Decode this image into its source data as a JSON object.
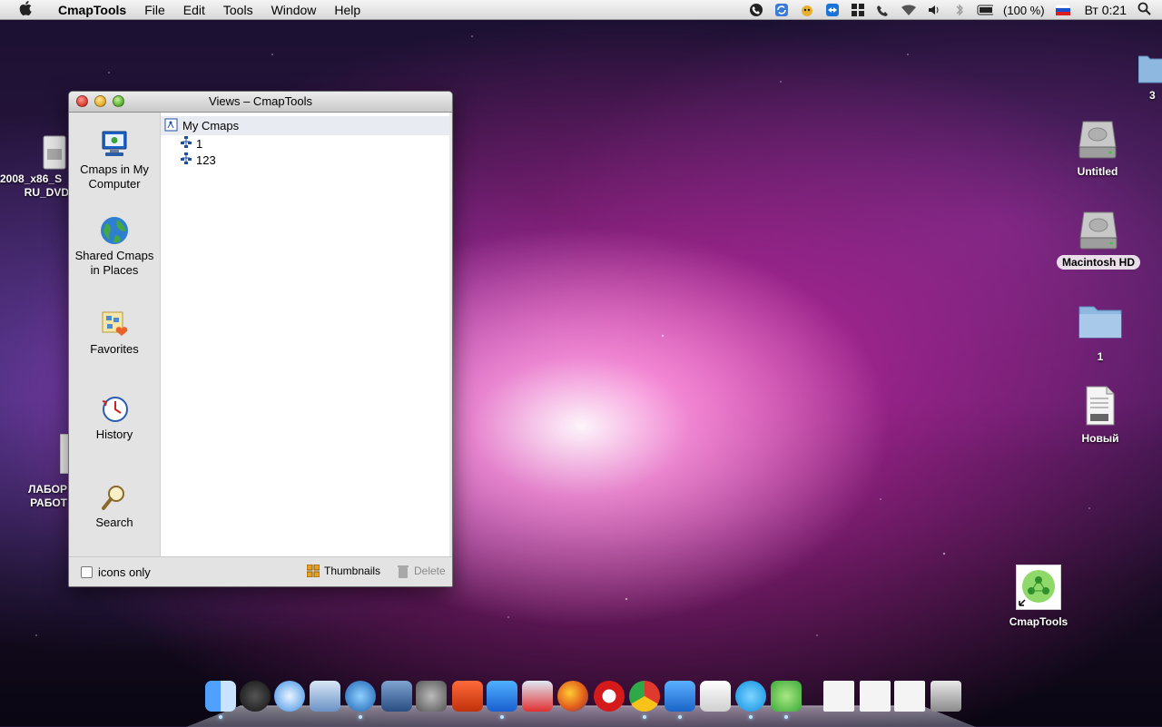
{
  "menubar": {
    "apple_glyph": "",
    "app_name": "CmapTools",
    "menus": [
      "File",
      "Edit",
      "Tools",
      "Window",
      "Help"
    ],
    "battery": "(100 %)",
    "clock": "Вт 0:21"
  },
  "window": {
    "title": "Views – CmapTools",
    "sidebar": [
      {
        "label": "Cmaps in My Computer",
        "icon": "computer-icon"
      },
      {
        "label": "Shared Cmaps in Places",
        "icon": "globe-icon"
      },
      {
        "label": "Favorites",
        "icon": "favorites-icon"
      },
      {
        "label": "History",
        "icon": "clock-icon"
      },
      {
        "label": "Search",
        "icon": "magnifier-icon"
      }
    ],
    "tree": {
      "root": "My Cmaps",
      "children": [
        "1",
        "123"
      ]
    },
    "bottom": {
      "icons_only": "icons only",
      "icons_only_checked": false,
      "thumbnails": "Thumbnails",
      "delete": "Delete"
    }
  },
  "desktop": {
    "left_icons": [
      {
        "label_line1": "2008_x86_S",
        "label_line2": "RU_DVD"
      },
      {
        "label_line1": "ЛАБОР",
        "label_line2": "РАБОТ"
      }
    ],
    "right_icons": [
      {
        "label": "3",
        "icon": "folder-icon"
      },
      {
        "label": "Untitled",
        "icon": "hard-drive-icon"
      },
      {
        "label": "Macintosh HD",
        "icon": "hard-drive-icon"
      },
      {
        "label": "1",
        "icon": "folder-icon"
      },
      {
        "label": "Новый",
        "icon": "rtfd-document-icon"
      },
      {
        "label": "CmapTools",
        "icon": "cmaptools-alias-icon"
      }
    ]
  },
  "dock": {
    "apps": [
      "Finder",
      "Dashboard",
      "Safari",
      "Mail",
      "iTunes",
      "Expose",
      "System Preferences",
      "PowerPoint",
      "Word",
      "Parallels",
      "Firefox",
      "Opera",
      "Chrome",
      "TeamViewer",
      "TextEdit",
      "Skype",
      "CmapTools",
      "Document 1",
      "Document 2",
      "Document 3",
      "Trash"
    ]
  },
  "colors": {
    "selection_row": "#e8ecf2",
    "accent_blue": "#1f5fbf"
  }
}
